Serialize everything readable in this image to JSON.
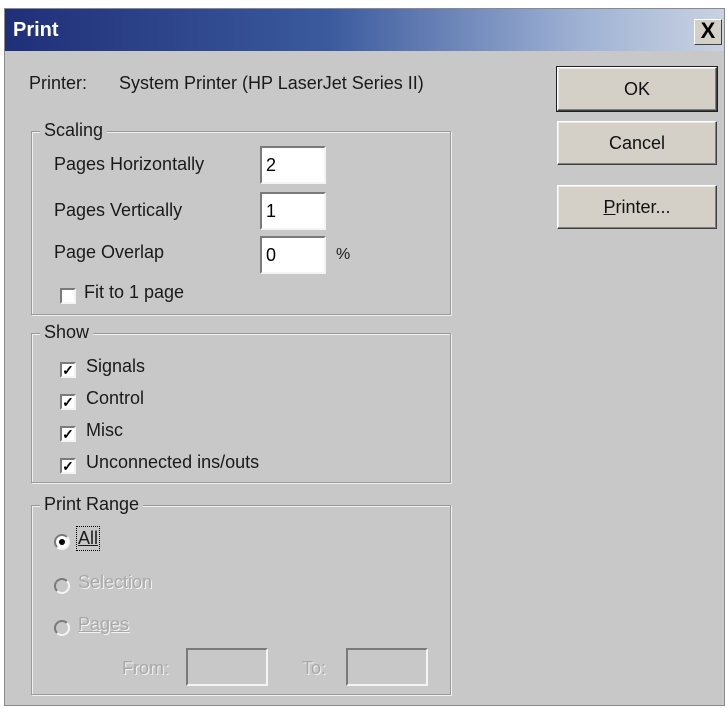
{
  "window": {
    "title": "Print",
    "close_glyph": "X"
  },
  "printer": {
    "label": "Printer:",
    "value": "System Printer (HP LaserJet Series II)"
  },
  "buttons": {
    "ok": "OK",
    "cancel": "Cancel",
    "printer_first": "P",
    "printer_rest": "rinter..."
  },
  "scaling": {
    "legend": "Scaling",
    "pages_horizontally_label": "Pages Horizontally",
    "pages_horizontally_value": "2",
    "pages_vertically_label": "Pages Vertically",
    "pages_vertically_value": "1",
    "page_overlap_label": "Page Overlap",
    "page_overlap_value": "0",
    "page_overlap_unit": "%",
    "fit_to_page_label": "Fit to 1 page",
    "fit_to_page_checked": false
  },
  "show": {
    "legend": "Show",
    "items": [
      {
        "label": "Signals",
        "checked": true,
        "mark": "✓"
      },
      {
        "label": "Control",
        "checked": true,
        "mark": "✓"
      },
      {
        "label": "Misc",
        "checked": true,
        "mark": "✓"
      },
      {
        "label": "Unconnected ins/outs",
        "checked": true,
        "mark": "✓"
      }
    ]
  },
  "print_range": {
    "legend": "Print Range",
    "all_label": "All",
    "selection_label": "Selection",
    "pages_label": "Pages",
    "from_label": "From:",
    "to_label": "To:",
    "selected": "All"
  }
}
